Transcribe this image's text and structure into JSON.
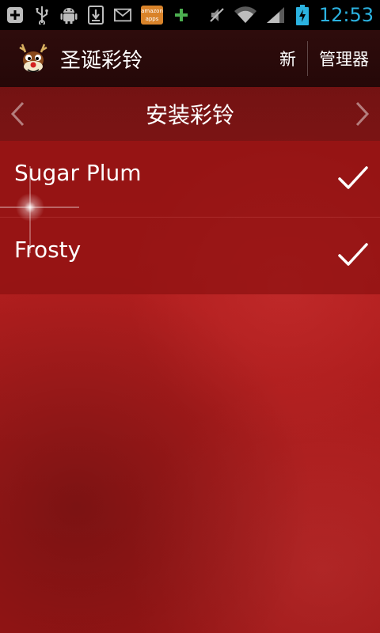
{
  "statusbar": {
    "left_icons": [
      "add-icon",
      "usb-icon",
      "android-debug-icon",
      "download-icon",
      "gmail-icon",
      "amazon-appstore-icon",
      "plus-icon"
    ],
    "amazon_text": "amazon",
    "amazon_subtext": "apps",
    "right_icons": [
      "mute-icon",
      "wifi-icon",
      "signal-icon",
      "battery-charging-icon"
    ],
    "time": "12:53",
    "time_color": "#2bb2e0"
  },
  "actionbar": {
    "logo": "reindeer-logo-icon",
    "title": "圣诞彩铃",
    "new_label": "新",
    "manage_label": "管理器"
  },
  "navbar": {
    "title": "安装彩铃",
    "prev_icon": "chevron-left-icon",
    "next_icon": "chevron-right-icon"
  },
  "list": {
    "items": [
      {
        "label": "Sugar Plum",
        "checked": true
      },
      {
        "label": "Frosty",
        "checked": true
      }
    ]
  },
  "colors": {
    "background": "#b41f1f",
    "actionbar": "#2e0c0c",
    "list_item": "#8c1010"
  }
}
